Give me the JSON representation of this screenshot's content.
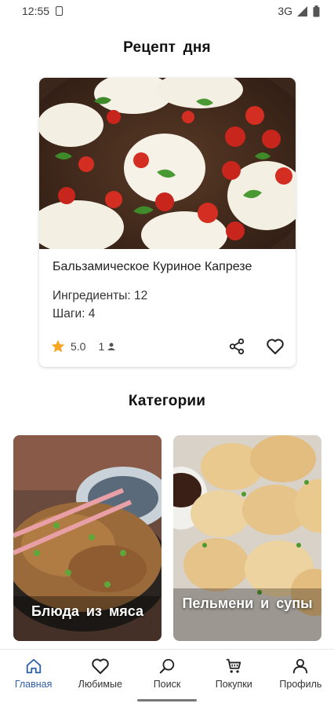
{
  "status_bar": {
    "time": "12:55",
    "network": "3G"
  },
  "recipe_of_day": {
    "section_title": "Рецепт дня",
    "name": "Бальзамическое Куриное Капрезе",
    "ingredients": "Ингредиенты: 12",
    "steps": "Шаги: 4",
    "rating": "5.0",
    "users": "1",
    "icons": {
      "star": "star-icon",
      "share": "share-icon",
      "favorite": "heart-icon",
      "users": "person-icon"
    },
    "colors": {
      "star": "#f5a623"
    }
  },
  "categories": {
    "section_title": "Категории",
    "items": [
      {
        "label": "Блюда из мяса"
      },
      {
        "label": "Пельмени и супы"
      }
    ]
  },
  "bottom_nav": {
    "items": [
      {
        "label": "Главная",
        "icon": "home-icon",
        "active": true
      },
      {
        "label": "Любимые",
        "icon": "heart-icon",
        "active": false
      },
      {
        "label": "Поиск",
        "icon": "search-icon",
        "active": false
      },
      {
        "label": "Покупки",
        "icon": "cart-icon",
        "active": false
      },
      {
        "label": "Профиль",
        "icon": "profile-icon",
        "active": false
      }
    ],
    "colors": {
      "active": "#2f5fa8"
    }
  }
}
